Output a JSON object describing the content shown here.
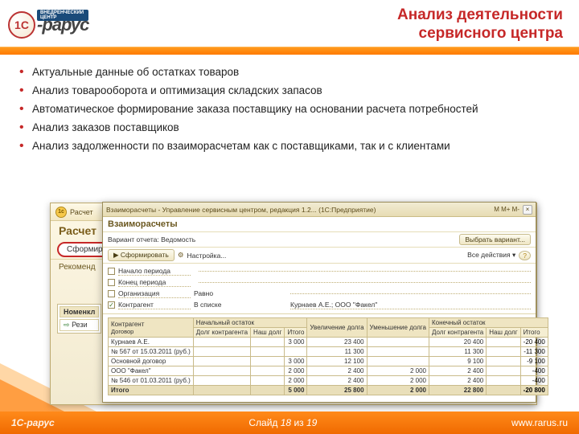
{
  "logo": {
    "mark": "1C",
    "brand": "-рарус",
    "tag": "ВНЕДРЕНЧЕСКИЙ ЦЕНТР"
  },
  "title": {
    "l1": "Анализ деятельности",
    "l2": "сервисного центра"
  },
  "bullets": [
    "Актуальные данные об остатках товаров",
    "Анализ товарооборота и оптимизация складских запасов",
    "Автоматическое формирование заказа поставщику на основании расчета потребностей",
    "Анализ заказов поставщиков",
    "Анализ задолженности по взаиморасчетам как с поставщиками, так и с клиентами"
  ],
  "back": {
    "top_label": "Расчет",
    "heading": "Расчет",
    "form_btn": "Сформир",
    "rec_label": "Рекоменд",
    "nom_header": "Номенкл",
    "nom_arrow": "⇨",
    "nom_item": "Рези"
  },
  "front": {
    "wtitle": "Взаиморасчеты - Управление сервисным центром, редакция 1.2... (1С:Предприятие)",
    "wtools": "M  M+  M-",
    "heading": "Взаиморасчеты",
    "variant_label": "Вариант отчета:",
    "variant_value": "Ведомость",
    "choose_btn": "Выбрать вариант...",
    "form_btn": "Сформировать",
    "settings": "Настройка...",
    "all_actions": "Все действия ▾",
    "help": "?",
    "params": [
      {
        "checked": false,
        "label": "Начало периода",
        "op": "",
        "value": ""
      },
      {
        "checked": false,
        "label": "Конец периода",
        "op": "",
        "value": ""
      },
      {
        "checked": false,
        "label": "Организация",
        "op": "Равно",
        "value": ""
      },
      {
        "checked": true,
        "label": "Контрагент",
        "op": "В списке",
        "value": "Курнаев А.Е.; ООО \"Факел\""
      }
    ],
    "columns": {
      "group1": "Контрагент",
      "group1_sub": "Договор",
      "begin": "Начальный остаток",
      "begin_debt": "Долг контрагента",
      "begin_our": "Наш долг",
      "begin_tot": "Итого",
      "inc": "Увеличение долга",
      "dec": "Уменьшение долга",
      "end": "Конечный остаток",
      "end_debt": "Долг контрагента",
      "end_our": "Наш долг",
      "end_tot": "Итого"
    },
    "rows": [
      {
        "name": "Курнаев А.Е.",
        "b_tot": "3 000",
        "inc": "23 400",
        "dec": "",
        "e_debt": "20 400",
        "e_our": "",
        "e_tot": "-20 400"
      },
      {
        "name": "   № 567 от 15.03.2011 (руб.)",
        "b_tot": "",
        "inc": "11 300",
        "dec": "",
        "e_debt": "11 300",
        "e_our": "",
        "e_tot": "-11 300"
      },
      {
        "name": "   Основной договор",
        "b_tot": "3 000",
        "inc": "12 100",
        "dec": "",
        "e_debt": "9 100",
        "e_our": "",
        "e_tot": "-9 100"
      },
      {
        "name": "ООО \"Факел\"",
        "b_tot": "2 000",
        "inc": "2 400",
        "dec": "2 000",
        "e_debt": "2 400",
        "e_our": "",
        "e_tot": "-400"
      },
      {
        "name": "   № 546 от 01.03.2011 (руб.)",
        "b_tot": "2 000",
        "inc": "2 400",
        "dec": "2 000",
        "e_debt": "2 400",
        "e_our": "",
        "e_tot": "-400"
      }
    ],
    "total": {
      "name": "Итого",
      "b_tot": "5 000",
      "inc": "25 800",
      "dec": "2 000",
      "e_debt": "22 800",
      "e_our": "",
      "e_tot": "-20 800"
    }
  },
  "footer": {
    "logo": "1С-рарус",
    "slide_prefix": "Слайд ",
    "slide_n": "18",
    "slide_mid": " из  ",
    "slide_total": "19",
    "site": "www.rarus.ru"
  }
}
